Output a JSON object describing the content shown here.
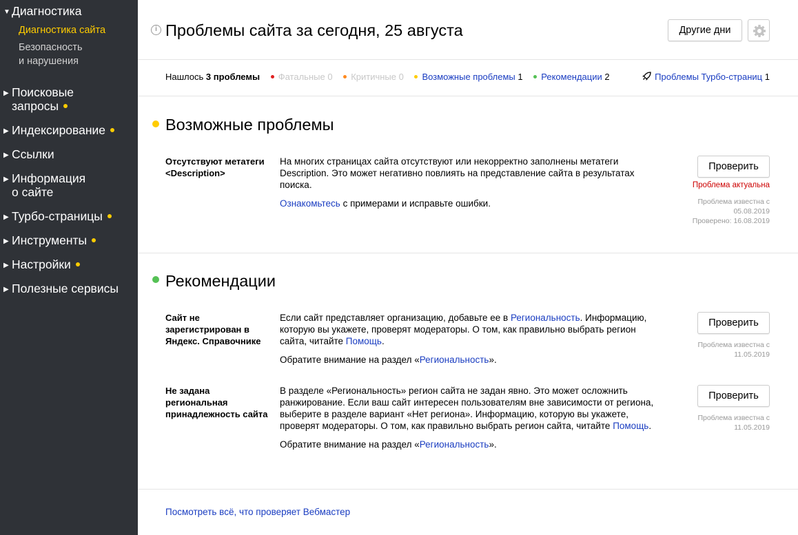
{
  "sidebar": {
    "diagnostics": {
      "label": "Диагностика"
    },
    "sub_items": [
      {
        "label": "Диагностика сайта"
      },
      {
        "label_line1": "Безопасность",
        "label_line2": "и нарушения"
      }
    ],
    "items": [
      {
        "label_line1": "Поисковые",
        "label_line2": "запросы"
      },
      {
        "label": "Индексирование"
      },
      {
        "label": "Ссылки"
      },
      {
        "label_line1": "Информация",
        "label_line2": "о сайте"
      },
      {
        "label": "Турбо-страницы"
      },
      {
        "label": "Инструменты"
      },
      {
        "label": "Настройки"
      },
      {
        "label": "Полезные сервисы"
      }
    ]
  },
  "header": {
    "info_icon": "i",
    "title": "Проблемы сайта за сегодня, 25 августа",
    "other_days": "Другие дни",
    "gear_icon": "gear-icon"
  },
  "summary": {
    "found_prefix": "Нашлось",
    "found_count": "3",
    "found_suffix": "проблемы",
    "fatal_label": "Фатальные",
    "fatal_count": "0",
    "critical_label": "Критичные",
    "critical_count": "0",
    "possible_label": "Возможные проблемы",
    "possible_count": "1",
    "recs_label": "Рекомендации",
    "recs_count": "2",
    "turbo_label": "Проблемы Турбо-страниц",
    "turbo_count": "1"
  },
  "colors": {
    "sidebar_bg": "#2f3237",
    "accent_yellow": "#ffcc00",
    "fatal_red": "#e02020",
    "critical_orange": "#ff8a1f",
    "possible_yellow": "#ffcc00",
    "recs_green": "#55c155",
    "link": "#1a3dc1",
    "status_red": "#cc0000"
  },
  "sections": {
    "possible": {
      "title": "Возможные проблемы",
      "issues": [
        {
          "name": "Отсутствуют метатеги <Description>",
          "desc": "На многих страницах сайта отсутствуют или некорректно заполнены метатеги Description. Это может негативно повлиять на представление сайта в результатах поиска.",
          "hint_link": "Ознакомьтесь",
          "hint_rest": " с примерами и исправьте ошибки.",
          "button": "Проверить",
          "status": "Проблема актуальна",
          "known_label": "Проблема известна с",
          "known_date": "05.08.2019",
          "checked": "Проверено: 16.08.2019"
        }
      ]
    },
    "recs": {
      "title": "Рекомендации",
      "issues": [
        {
          "name": "Сайт не зарегистрирован в Яндекс. Справочнике",
          "desc_a": "Если сайт представляет организацию, добавьте ее в ",
          "desc_link1": "Региональность",
          "desc_b": ". Информацию, которую вы укажете, проверят модераторы. О том, как правильно выбрать регион сайта, читайте ",
          "desc_link2": "Помощь",
          "desc_c": ".",
          "note_a": "Обратите внимание на раздел «",
          "note_link": "Региональность",
          "note_b": "».",
          "button": "Проверить",
          "known_label": "Проблема известна с",
          "known_date": "11.05.2019"
        },
        {
          "name": "Не задана региональная принадлежность сайта",
          "desc_a": "В разделе «Региональность» регион сайта не задан явно. Это может осложнить ранжирование. Если ваш сайт интересен пользователям вне зависимости от региона, выберите в разделе вариант «Нет региона». Информацию, которую вы укажете, проверят модераторы. О том, как правильно выбрать регион сайта, читайте ",
          "desc_link": "Помощь",
          "desc_b": ".",
          "note_a": "Обратите внимание на раздел «",
          "note_link": "Региональность",
          "note_b": "».",
          "button": "Проверить",
          "known_label": "Проблема известна с",
          "known_date": "11.05.2019"
        }
      ]
    }
  },
  "footer": {
    "link": "Посмотреть всё, что проверяет Вебмастер"
  }
}
